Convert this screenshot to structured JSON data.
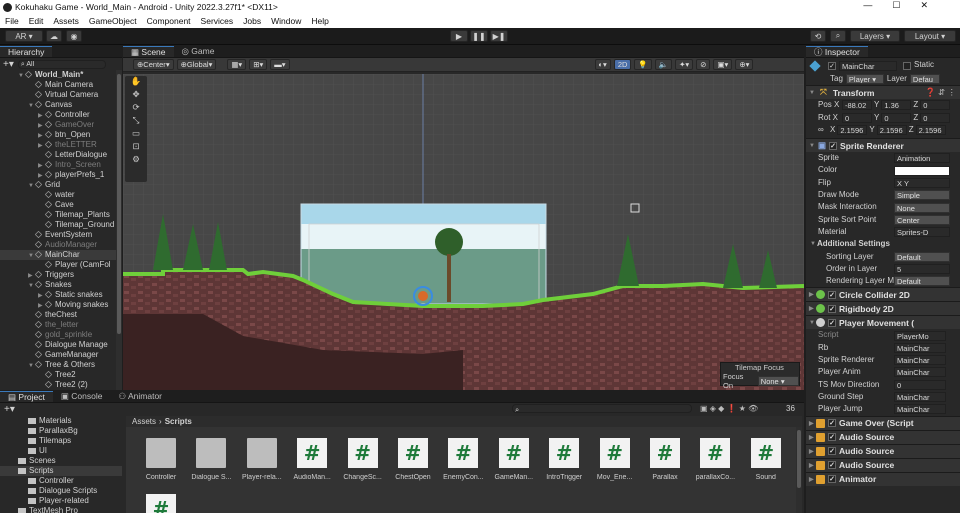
{
  "window": {
    "title": "Kokuhaku Game - World_Main - Android - Unity 2022.3.27f1* <DX11>"
  },
  "menu": [
    "File",
    "Edit",
    "Assets",
    "GameObject",
    "Component",
    "Services",
    "Jobs",
    "Window",
    "Help"
  ],
  "toolbar": {
    "account": "AR",
    "layers": "Layers",
    "layout": "Layout"
  },
  "hierarchy": {
    "tab": "Hierarchy",
    "search_placeholder": "All",
    "scene": "World_Main*",
    "items": [
      {
        "label": "Main Camera",
        "indent": 1,
        "dim": false,
        "arrow": ""
      },
      {
        "label": "Virtual Camera",
        "indent": 1,
        "dim": false,
        "arrow": ""
      },
      {
        "label": "Canvas",
        "indent": 1,
        "dim": false,
        "arrow": "▼"
      },
      {
        "label": "Controller",
        "indent": 2,
        "dim": false,
        "arrow": "▶"
      },
      {
        "label": "GameOver",
        "indent": 2,
        "dim": true,
        "arrow": "▶"
      },
      {
        "label": "btn_Open",
        "indent": 2,
        "dim": false,
        "arrow": "▶"
      },
      {
        "label": "theLETTER",
        "indent": 2,
        "dim": true,
        "arrow": "▶"
      },
      {
        "label": "LetterDialogue",
        "indent": 2,
        "dim": false,
        "arrow": ""
      },
      {
        "label": "Intro_Screen",
        "indent": 2,
        "dim": true,
        "arrow": "▶"
      },
      {
        "label": "playerPrefs_1",
        "indent": 2,
        "dim": false,
        "arrow": "▶"
      },
      {
        "label": "Grid",
        "indent": 1,
        "dim": false,
        "arrow": "▼"
      },
      {
        "label": "water",
        "indent": 2,
        "dim": false,
        "arrow": ""
      },
      {
        "label": "Cave",
        "indent": 2,
        "dim": false,
        "arrow": ""
      },
      {
        "label": "Tilemap_Plants",
        "indent": 2,
        "dim": false,
        "arrow": ""
      },
      {
        "label": "Tilemap_Ground",
        "indent": 2,
        "dim": false,
        "arrow": ""
      },
      {
        "label": "EventSystem",
        "indent": 1,
        "dim": false,
        "arrow": ""
      },
      {
        "label": "AudioManager",
        "indent": 1,
        "dim": true,
        "arrow": ""
      },
      {
        "label": "MainChar",
        "indent": 1,
        "dim": false,
        "arrow": "▼",
        "selected": true
      },
      {
        "label": "Player (CamFol",
        "indent": 2,
        "dim": false,
        "arrow": ""
      },
      {
        "label": "Triggers",
        "indent": 1,
        "dim": false,
        "arrow": "▶"
      },
      {
        "label": "Snakes",
        "indent": 1,
        "dim": false,
        "arrow": "▼"
      },
      {
        "label": "Static snakes",
        "indent": 2,
        "dim": false,
        "arrow": "▶"
      },
      {
        "label": "Moving snakes",
        "indent": 2,
        "dim": false,
        "arrow": "▶"
      },
      {
        "label": "theChest",
        "indent": 1,
        "dim": false,
        "arrow": ""
      },
      {
        "label": "the_letter",
        "indent": 1,
        "dim": true,
        "arrow": ""
      },
      {
        "label": "gold_sprinkle",
        "indent": 1,
        "dim": true,
        "arrow": ""
      },
      {
        "label": "Dialogue Manage",
        "indent": 1,
        "dim": false,
        "arrow": ""
      },
      {
        "label": "GameManager",
        "indent": 1,
        "dim": false,
        "arrow": ""
      },
      {
        "label": "Tree & Others",
        "indent": 1,
        "dim": false,
        "arrow": "▼"
      },
      {
        "label": "Tree2",
        "indent": 2,
        "dim": false,
        "arrow": ""
      },
      {
        "label": "Tree2 (2)",
        "indent": 2,
        "dim": false,
        "arrow": ""
      }
    ]
  },
  "scene_view": {
    "tabs": [
      "Scene",
      "Game"
    ],
    "pivot": "Center",
    "space": "Global",
    "mode_2d": "2D",
    "tilemap_focus": {
      "title": "Tilemap Focus",
      "label": "Focus On",
      "value": "None"
    }
  },
  "inspector": {
    "tab": "Inspector",
    "object_name": "MainChar",
    "static_label": "Static",
    "tag_label": "Tag",
    "tag_value": "Player",
    "layer_label": "Layer",
    "layer_value": "Defau",
    "transform": {
      "title": "Transform",
      "pos_label": "Pos X",
      "pos": [
        "-88.02",
        "1.36",
        "0"
      ],
      "rot_label": "Rot X",
      "rot": [
        "0",
        "0",
        "0"
      ],
      "scale": [
        "2.1596",
        "2.1596",
        "2.1596"
      ]
    },
    "sprite_renderer": {
      "title": "Sprite Renderer",
      "fields": [
        {
          "label": "Sprite",
          "value": "Animation"
        },
        {
          "label": "Color",
          "value": ""
        },
        {
          "label": "Flip",
          "value": "X    Y"
        },
        {
          "label": "Draw Mode",
          "value": "Simple"
        },
        {
          "label": "Mask Interaction",
          "value": "None"
        },
        {
          "label": "Sprite Sort Point",
          "value": "Center"
        },
        {
          "label": "Material",
          "value": "Sprites-D"
        }
      ],
      "additional": "Additional Settings",
      "extra": [
        {
          "label": "Sorting Layer",
          "value": "Default"
        },
        {
          "label": "Order in Layer",
          "value": "5"
        },
        {
          "label": "Rendering Layer M",
          "value": "Default"
        }
      ]
    },
    "components": [
      {
        "title": "Circle Collider 2D",
        "color": "#6cc24a"
      },
      {
        "title": "Rigidbody 2D",
        "color": "#6cc24a"
      },
      {
        "title": "Player Movement (",
        "color": "#cfcfcf"
      }
    ],
    "player_movement": [
      {
        "label": "Script",
        "value": "PlayerMo",
        "dim": true
      },
      {
        "label": "Rb",
        "value": "MainChar"
      },
      {
        "label": "Sprite Renderer",
        "value": "MainChar"
      },
      {
        "label": "Player Anim",
        "value": "MainChar"
      },
      {
        "label": "TS Mov Direction",
        "value": "0"
      },
      {
        "label": "Ground Step",
        "value": "MainChar"
      },
      {
        "label": "Player Jump",
        "value": "MainChar"
      }
    ],
    "more_components": [
      "Game Over (Script",
      "Audio Source",
      "Audio Source",
      "Audio Source",
      "Animator"
    ]
  },
  "project": {
    "tabs": [
      "Project",
      "Console",
      "Animator"
    ],
    "tree": [
      {
        "label": "Materials",
        "indent": 2
      },
      {
        "label": "ParallaxBg",
        "indent": 2
      },
      {
        "label": "Tilemaps",
        "indent": 2
      },
      {
        "label": "UI",
        "indent": 2
      },
      {
        "label": "Scenes",
        "indent": 1
      },
      {
        "label": "Scripts",
        "indent": 1,
        "selected": true
      },
      {
        "label": "Controller",
        "indent": 2
      },
      {
        "label": "Dialogue Scripts",
        "indent": 2
      },
      {
        "label": "Player-related",
        "indent": 2
      },
      {
        "label": "TextMesh Pro",
        "indent": 1
      }
    ],
    "breadcrumb": [
      "Assets",
      "Scripts"
    ],
    "count": "36",
    "assets": [
      {
        "label": "Controller",
        "kind": "folder"
      },
      {
        "label": "Dialogue S...",
        "kind": "folder"
      },
      {
        "label": "Player-rela...",
        "kind": "folder"
      },
      {
        "label": "AudioMan...",
        "kind": "script"
      },
      {
        "label": "ChangeSc...",
        "kind": "script"
      },
      {
        "label": "ChestOpen",
        "kind": "script"
      },
      {
        "label": "EnemyCon...",
        "kind": "script"
      },
      {
        "label": "GameMan...",
        "kind": "script"
      },
      {
        "label": "IntroTrigger",
        "kind": "script"
      },
      {
        "label": "Mov_Ene...",
        "kind": "script"
      },
      {
        "label": "Parallax",
        "kind": "script"
      },
      {
        "label": "parallaxCo...",
        "kind": "script"
      },
      {
        "label": "Sound",
        "kind": "script"
      },
      {
        "label": "",
        "kind": "script"
      }
    ]
  }
}
